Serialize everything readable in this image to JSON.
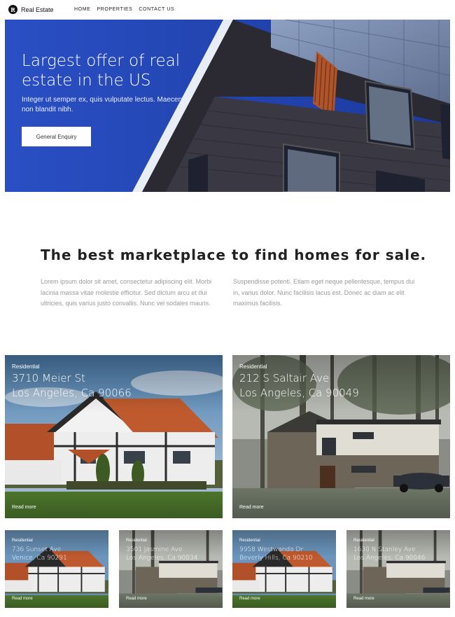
{
  "brand": {
    "logo_letter": "R",
    "name": "Real Estate"
  },
  "nav": {
    "items": [
      "HOME",
      "PROPERTIES",
      "CONTACT US"
    ]
  },
  "hero": {
    "title": "Largest offer of real estate in the US",
    "subtitle": "Integer ut semper ex, quis vulputate lectus. Maecenas non blandit nibh.",
    "button": "General Enquiry",
    "accent": "#1f43b0"
  },
  "intro": {
    "title": "The best marketplace to find homes for sale.",
    "left": "Lorem ipsum dolor sit amet, consectetur adipiscing elit. Morbi lacinia massa vitae molestie efficitur. Sed dictum arcu et dui ultricies, quis varius justo convallis. Nunc vel sodales mauris.",
    "right": "Suspendisse potenti. Etiam eget neque pellentesque, tempus dui in, varius dolor. Nunc facilisis lacus est. Donec ac diam ac elit maximus facilisis."
  },
  "listings": [
    {
      "type": "Residential",
      "line1": "3710 Meier St",
      "line2": "Los Angeles, Ca 90066",
      "link": "Read more"
    },
    {
      "type": "Residential",
      "line1": "212 S Saltair Ave",
      "line2": "Los Angeles, Ca 90049",
      "link": "Read more"
    },
    {
      "type": "Residential",
      "line1": "736 Sunset Ave",
      "line2": "Venice, Ca 90291",
      "link": "Read more"
    },
    {
      "type": "Residential",
      "line1": "3501 Jasmine Ave",
      "line2": "Los Angeles, Ca 90034",
      "link": "Read more"
    },
    {
      "type": "Residential",
      "line1": "9958 Westwanda Dr",
      "line2": "Beverly Hills, Ca 90210",
      "link": "Read more"
    },
    {
      "type": "Residential",
      "line1": "1630 N Stanley Ave",
      "line2": "Los Angeles, Ca 90046",
      "link": "Read more"
    }
  ]
}
